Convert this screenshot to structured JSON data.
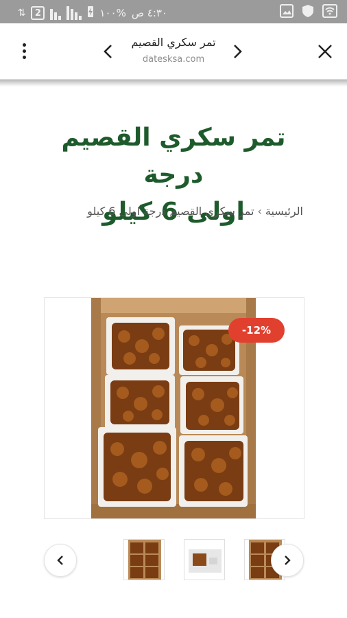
{
  "status_bar": {
    "time": "٤:٣٠ ص",
    "battery": "%١٠٠",
    "sim_badge": "2",
    "colors": {
      "bar": "#9b9b9b"
    }
  },
  "toolbar": {
    "page_title": "تمر سكري القصيم",
    "url": "datesksa.com",
    "icons": {
      "close": "close-icon",
      "back": "chevron-left-icon",
      "forward": "chevron-right-icon",
      "menu": "more-vert-icon"
    }
  },
  "product": {
    "title_line1": "تمر سكري القصيم درجة",
    "title_line2": "اولى 6 كيلو",
    "title_color": "#1e5b2c"
  },
  "breadcrumb": {
    "home": "الرئيسية",
    "separator": "›",
    "current": "تمر سكري القصيم درجة اولى 6 كيلو"
  },
  "gallery": {
    "sale_badge": "-12%",
    "badge_color": "#e2402f",
    "thumbnails_count": 3
  }
}
